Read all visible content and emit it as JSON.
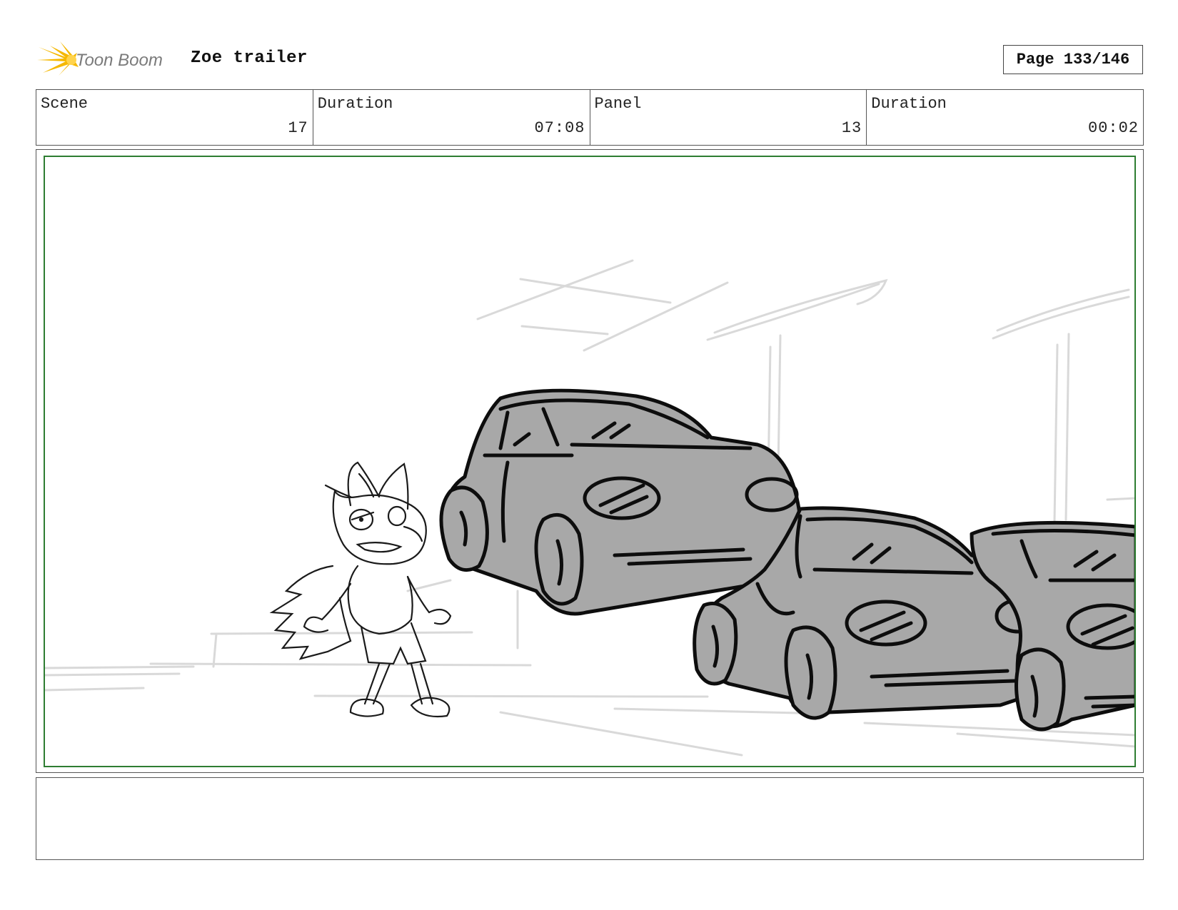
{
  "header": {
    "brand": "Toon Boom",
    "project_title": "Zoe trailer",
    "page_label": "Page 133/146"
  },
  "info": {
    "scene_label": "Scene",
    "scene_value": "17",
    "scene_duration_label": "Duration",
    "scene_duration_value": "07:08",
    "panel_label": "Panel",
    "panel_value": "13",
    "panel_duration_label": "Duration",
    "panel_duration_value": "00:02"
  },
  "notes": {
    "text": ""
  },
  "colors": {
    "safe_frame": "#2e7d32",
    "car_fill": "#a8a8a8",
    "logo_accent": "#f5b800",
    "logo_text": "#7a7a7a",
    "background_lines": "#d6d6d6"
  }
}
